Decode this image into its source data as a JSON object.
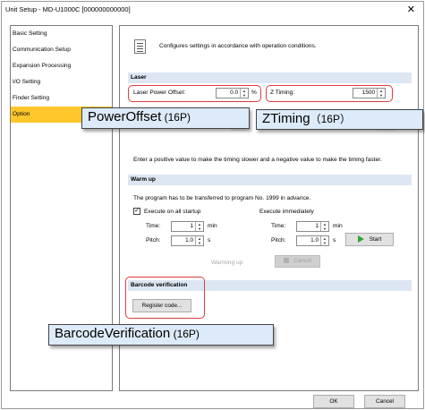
{
  "window": {
    "title": "Unit Setup - MD-U1000C [000000000000]",
    "close_glyph": "✕"
  },
  "sidebar": {
    "items": [
      {
        "label": "Basic Setting"
      },
      {
        "label": "Communication Setup"
      },
      {
        "label": "Expansion Processing"
      },
      {
        "label": "I/O Setting"
      },
      {
        "label": "Finder Setting"
      },
      {
        "label": "Option",
        "active": true
      }
    ]
  },
  "header": {
    "icon": "document-icon",
    "text": "Configures settings in accordance with operation conditions."
  },
  "laser": {
    "section_title": "Laser",
    "power_offset_label": "Laser Power Offset:",
    "power_offset_value": "0.0",
    "power_offset_unit": "%",
    "z_timing_label": "Z Timing:",
    "z_timing_value": "1500"
  },
  "timing_note": "Enter a positive value to make the timing slower and a negative value to make the timing faster.",
  "warmup": {
    "section_title": "Warm up",
    "note": "The program has to be transferred to program No. 1999 in advance.",
    "startup_checkbox_label": "Execute on all startup",
    "startup_checked": true,
    "immediate_label": "Execute immediately",
    "time_label": "Time:",
    "time_value": "1",
    "time_unit": "min",
    "pitch_label": "Pitch:",
    "pitch_value": "1.0",
    "pitch_unit": "s",
    "imm_time_label": "Time:",
    "imm_time_value": "1",
    "imm_time_unit": "min",
    "imm_pitch_label": "Pitch:",
    "imm_pitch_value": "1.0",
    "imm_pitch_unit": "s",
    "start_label": "Start",
    "status_text": "Warming up",
    "cancel_label": "Cancel"
  },
  "barcode": {
    "section_title": "Barcode verification",
    "register_label": "Register code..."
  },
  "callouts": {
    "power_offset_main": "PowerOffset",
    "power_offset_small": " (16P)",
    "z_timing_main": "ZTiming",
    "z_timing_small": "（16P）",
    "barcode_main": "BarcodeVerification",
    "barcode_small": " (16P)"
  },
  "footer": {
    "ok_label": "OK",
    "cancel_label": "Cancel"
  },
  "colors": {
    "highlight": "#ffc72c",
    "section_bg": "#dde6f3",
    "callout_bg": "#ddeaf9",
    "annotation_red": "#e03c3c"
  }
}
